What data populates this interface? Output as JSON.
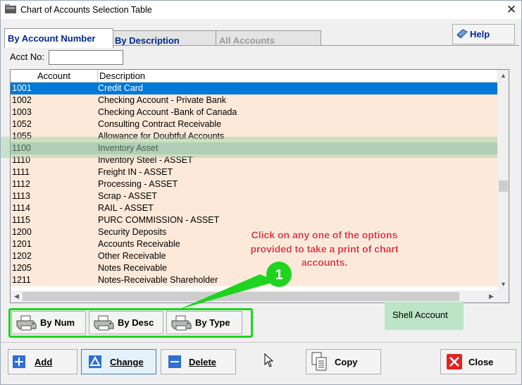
{
  "window": {
    "title": "Chart of Accounts Selection Table",
    "close_glyph": "✕"
  },
  "tabs": [
    {
      "label": "By Account Number",
      "state": "active"
    },
    {
      "label": "By Description",
      "state": "normal"
    },
    {
      "label": "All Accounts",
      "state": "disabled"
    }
  ],
  "help": {
    "label": "Help",
    "icon": "help-book-icon"
  },
  "search": {
    "label": "Acct No:",
    "value": ""
  },
  "grid": {
    "columns": [
      "Account",
      "Description"
    ],
    "selected_index": 0,
    "highlight_index": 5,
    "rows": [
      {
        "account": "1001",
        "description": "Credit Card"
      },
      {
        "account": "1002",
        "description": "Checking Account - Private Bank"
      },
      {
        "account": "1003",
        "description": "Checking Account -Bank of Canada"
      },
      {
        "account": "1052",
        "description": "Consulting Contract Receivable"
      },
      {
        "account": "1055",
        "description": "Allowance for Doubtful Accounts"
      },
      {
        "account": "1100",
        "description": "Inventory Asset"
      },
      {
        "account": "1110",
        "description": "Inventory Steel - ASSET"
      },
      {
        "account": "1111",
        "description": "Freight IN - ASSET"
      },
      {
        "account": "1112",
        "description": "Processing - ASSET"
      },
      {
        "account": "1113",
        "description": "Scrap - ASSET"
      },
      {
        "account": "1114",
        "description": "RAIL - ASSET"
      },
      {
        "account": "1115",
        "description": "PURC COMMISSION - ASSET"
      },
      {
        "account": "1200",
        "description": "Security Deposits"
      },
      {
        "account": "1201",
        "description": "Accounts Receivable"
      },
      {
        "account": "1202",
        "description": "Other Receivable"
      },
      {
        "account": "1205",
        "description": "Notes Receivable"
      },
      {
        "account": "1211",
        "description": "Notes-Receivable Shareholder"
      }
    ]
  },
  "callout": {
    "text": "Click on any one of the options provided to take a print of chart accounts.",
    "marker_number": "1",
    "accent_color": "#1fd41f",
    "text_color": "#e03b3b"
  },
  "print_buttons": [
    {
      "label": "By Num",
      "icon": "printer-icon"
    },
    {
      "label": "By Desc",
      "icon": "printer-icon"
    },
    {
      "label": "By Type",
      "icon": "printer-icon"
    }
  ],
  "shell_account": {
    "label": "Shell Account"
  },
  "actions": {
    "add": "Add",
    "change": "Change",
    "delete": "Delete",
    "copy": "Copy",
    "close": "Close"
  },
  "colors": {
    "row_background": "#fde9d9",
    "selected_row": "#0078d7",
    "tab_text": "#002a8c",
    "close_red": "#e02424"
  }
}
